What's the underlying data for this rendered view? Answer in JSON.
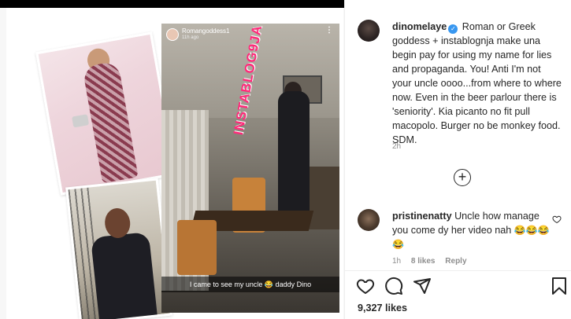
{
  "story": {
    "username": "Romangoddess1",
    "time": "11h ago",
    "watermark": "INSTABLOG9JA",
    "caption": "I came to see my uncle 😂 daddy Dino"
  },
  "post": {
    "username": "dinomelaye",
    "verified": true,
    "caption": "Roman or Greek goddess + instablognja make una begin pay for using my name for lies and propaganda. You! Anti I'm not your uncle oooo...from where to where now. Even in the beer parlour there is 'seniority'. Kia picanto no fit pull macopolo. Burger no be monkey food. SDM.",
    "time": "2h"
  },
  "load_more": {
    "icon": "plus-circle-icon"
  },
  "comment": {
    "username": "pristinenatty",
    "text": "Uncle how manage you come dy her video nah",
    "emojis": "😂😂😂😂",
    "time": "1h",
    "likes": "8 likes",
    "reply": "Reply"
  },
  "actions": {
    "icons": [
      "heart-icon",
      "comment-icon",
      "share-icon",
      "bookmark-icon"
    ]
  },
  "likes_count": "9,327 likes",
  "colors": {
    "verified": "#3897f0",
    "text": "#262626",
    "muted": "#8e8e8e",
    "watermark": "#ff2a7a"
  }
}
